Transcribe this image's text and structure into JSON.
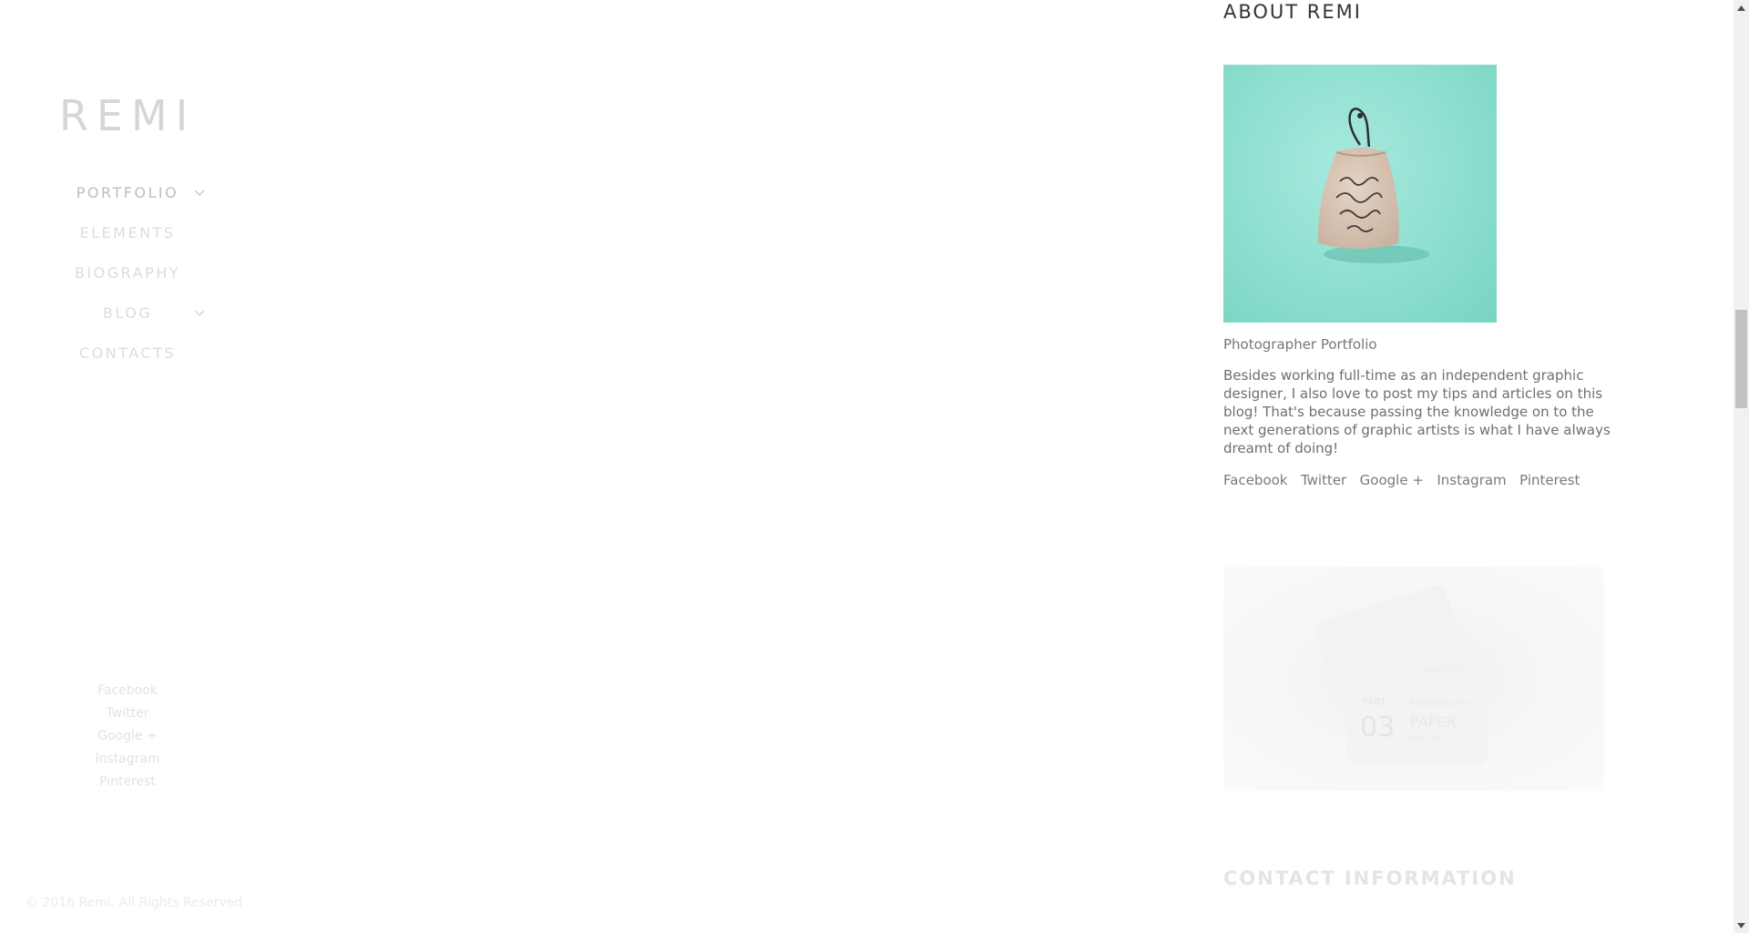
{
  "site": {
    "logo": "REMI"
  },
  "nav": {
    "items": [
      {
        "label": "PORTFOLIO",
        "has_submenu": true
      },
      {
        "label": "ELEMENTS",
        "has_submenu": false
      },
      {
        "label": "BIOGRAPHY",
        "has_submenu": false
      },
      {
        "label": "BLOG",
        "has_submenu": true
      },
      {
        "label": "CONTACTS",
        "has_submenu": false
      }
    ]
  },
  "sidebar_social": [
    "Facebook",
    "Twitter",
    "Google +",
    "Instagram",
    "Pinterest"
  ],
  "footer": {
    "copyright": "© 2016 Remi. All Rights Reserved"
  },
  "about": {
    "title": "ABOUT REMI",
    "image_alt": "Fabric bag mockup",
    "caption": "Photographer Portfolio",
    "bio": "Besides working full-time as an independent graphic designer, I also love to post my tips and articles on this blog! That's because passing the knowledge on to the next generations of graphic artists is what I have always dreamt of doing!",
    "social": [
      "Facebook",
      "Twitter",
      "Google +",
      "Instagram",
      "Pinterest"
    ]
  },
  "card_image": {
    "part_text": "PART",
    "part_number": "03",
    "line1": "BUSINESS CARD",
    "line2": "PAPER",
    "line3": "MOCKUP"
  },
  "contact": {
    "title": "CONTACT INFORMATION"
  },
  "colors": {
    "accent_teal": "#8ddfcf",
    "text_dark": "#333333",
    "text_muted": "#777777",
    "nav_faded": "#dcdcdc"
  }
}
